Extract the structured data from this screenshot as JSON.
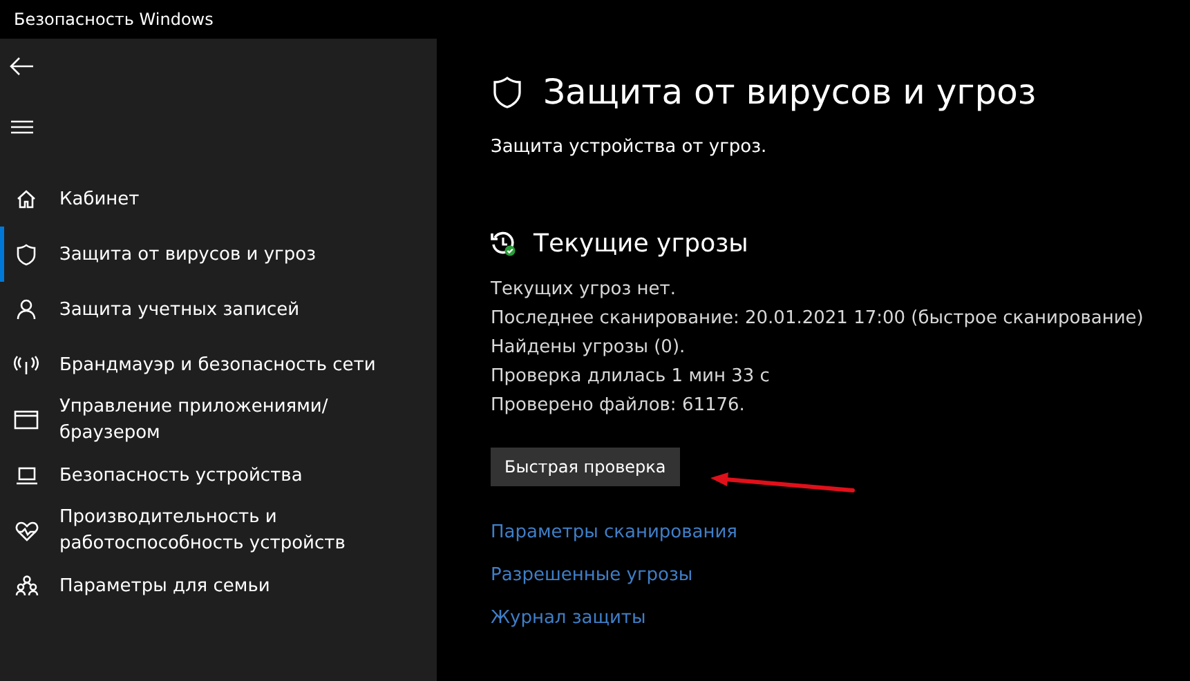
{
  "window": {
    "title": "Безопасность Windows"
  },
  "sidebar": {
    "items": [
      {
        "label": "Кабинет",
        "kind": "home",
        "selected": false
      },
      {
        "label": "Защита от вирусов и угроз",
        "kind": "shield",
        "selected": true
      },
      {
        "label": "Защита учетных записей",
        "kind": "person",
        "selected": false
      },
      {
        "label": "Брандмауэр и безопасность сети",
        "kind": "antenna",
        "selected": false
      },
      {
        "label": "Управление приложениями/браузером",
        "kind": "window",
        "selected": false
      },
      {
        "label": "Безопасность устройства",
        "kind": "laptop",
        "selected": false
      },
      {
        "label": "Производительность и работоспособность устройств",
        "kind": "heart",
        "selected": false
      },
      {
        "label": "Параметры для семьи",
        "kind": "family",
        "selected": false
      }
    ]
  },
  "main": {
    "title": "Защита от вирусов и угроз",
    "subtitle": "Защита устройства от угроз.",
    "section": {
      "title": "Текущие угрозы",
      "lines": [
        "Текущих угроз нет.",
        "Последнее сканирование: 20.01.2021 17:00 (быстрое сканирование)",
        "Найдены угрозы (0).",
        "Проверка длилась 1 мин 33 с",
        "Проверено файлов: 61176."
      ],
      "button": "Быстрая проверка",
      "links": [
        "Параметры сканирования",
        "Разрешенные угрозы",
        "Журнал защиты"
      ]
    }
  }
}
